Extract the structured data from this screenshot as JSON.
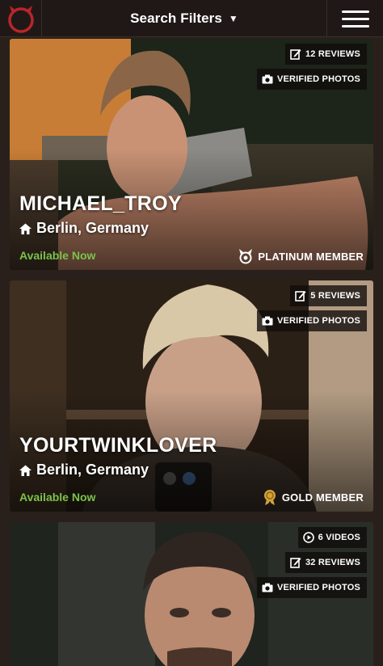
{
  "header": {
    "logo_icon": "devil-horns-logo-icon",
    "search_filters_label": "Search Filters",
    "menu_icon": "hamburger-menu-icon"
  },
  "colors": {
    "available": "#7cc24a",
    "gold": "#d4a136",
    "brand_red": "#b8262a"
  },
  "profiles": [
    {
      "name": "MICHAEL_TROY",
      "location": "Berlin, Germany",
      "status": "Available Now",
      "membership": "PLATINUM MEMBER",
      "membership_icon": "platinum-devil-icon",
      "badges": [
        {
          "icon": "edit-icon",
          "label": "12 REVIEWS"
        },
        {
          "icon": "camera-icon",
          "label": "VERIFIED PHOTOS"
        }
      ]
    },
    {
      "name": "YOURTWINKLOVER",
      "location": "Berlin, Germany",
      "status": "Available Now",
      "membership": "GOLD MEMBER",
      "membership_icon": "gold-medal-icon",
      "badges": [
        {
          "icon": "edit-icon",
          "label": "5 REVIEWS"
        },
        {
          "icon": "camera-icon",
          "label": "VERIFIED PHOTOS"
        }
      ]
    },
    {
      "badges": [
        {
          "icon": "play-icon",
          "label": "6 VIDEOS"
        },
        {
          "icon": "edit-icon",
          "label": "32 REVIEWS"
        },
        {
          "icon": "camera-icon",
          "label": "VERIFIED PHOTOS"
        }
      ]
    }
  ]
}
